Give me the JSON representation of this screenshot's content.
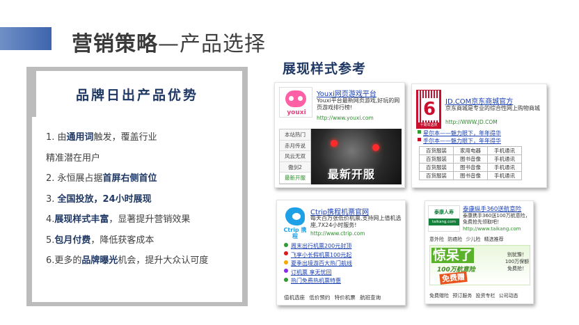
{
  "slide": {
    "title_bold": "营销策略",
    "title_rest": "—产品选择"
  },
  "left_panel": {
    "title": "品牌日出产品优势",
    "points": [
      {
        "pre": "1. 由",
        "bold": "通用词",
        "post": "触发，覆盖行业"
      },
      {
        "pre": "精准潜在用户",
        "bold": "",
        "post": ""
      },
      {
        "pre": "2. 永恒展占据",
        "bold": "首屏右侧首位",
        "post": ""
      },
      {
        "pre": "3. ",
        "bold": "全国投放，24小时展现",
        "post": ""
      },
      {
        "pre": "4.",
        "bold": "展现样式丰富",
        "post": "，显著提升营销效果"
      },
      {
        "pre": "5.",
        "bold": "包月付费",
        "post": "，降低获客成本"
      },
      {
        "pre": "6.更多的",
        "bold": "品牌曝光",
        "post": "机会，提升大众认可度"
      }
    ]
  },
  "right_section": {
    "title": "展现样式参考"
  },
  "card_youxi": {
    "logo_word": "youxi",
    "title": "Youxi网页游戏平台",
    "desc": "Youxi平台最新网页游戏,好玩的网页游戏排行榜!",
    "url": "http://www.youxi.com",
    "tabs": [
      "本站热门",
      "赤月传说",
      "风云无双",
      "傲剑2",
      "最新开服"
    ],
    "banner_text": "最新开服"
  },
  "card_jd": {
    "logo_num": "6",
    "logo_sub": "十周年店庆",
    "title": "JD.COM京东商城官方",
    "desc": "京东商城是专业的综合性网上购物商城",
    "url": "http://WWW.JD.COM",
    "links": [
      "星尔本——魅力眼下，年年得华",
      "手尔本——魅力眼下，年年得华"
    ],
    "link_colors": [
      "#2e9c2e",
      "#c8102e"
    ],
    "grid": [
      [
        "百货服装",
        "家用电器",
        "手机通讯"
      ],
      [
        "百货服装",
        "图书音像",
        "手机通讯"
      ],
      [
        "百货服装",
        "图书音像",
        "手机通讯"
      ],
      [
        "百货服装",
        "图书音像",
        "手机通讯"
      ]
    ]
  },
  "card_ctrip": {
    "logo_word": "Ctrip 携程",
    "title": "Ctrip携程机票官网",
    "desc": "每天百万张低价机票,支持网上值机选座,7X24小时服务!",
    "url": "http://www.ctrip.com",
    "links": [
      "周末出行机票200元封顶",
      "飞享小长假机票100元起",
      "夏季出境游百大热门航线",
      "订机票 享无忧回",
      "热门免费热机票特惠"
    ],
    "bullet_colors": [
      "#2e9c2e",
      "#d81b1b",
      "#f2a900",
      "#8a2be2",
      "#2e9c2e"
    ],
    "bottom_links": "值机选座 低价预约 特价机票 航班查询"
  },
  "card_taikang": {
    "logo_top": "泰康人寿",
    "logo_bar": "taikang.com",
    "title": "泰康纵手360送航意险",
    "desc": "泰康携手360送100万航意险，免费抢先领取吧！",
    "url": "http://www.taikang.com",
    "nav_row": "意外险 防癌险 少儿险 精选推荐",
    "banner_big": "惊呆了",
    "banner_mid": "100万航意险",
    "banner_free": "免费赠",
    "banner_side": "别犹豫！100万保额免费抢！",
    "bottom_row": "免费赠险 预订服务 投资专栏 公司动态"
  }
}
